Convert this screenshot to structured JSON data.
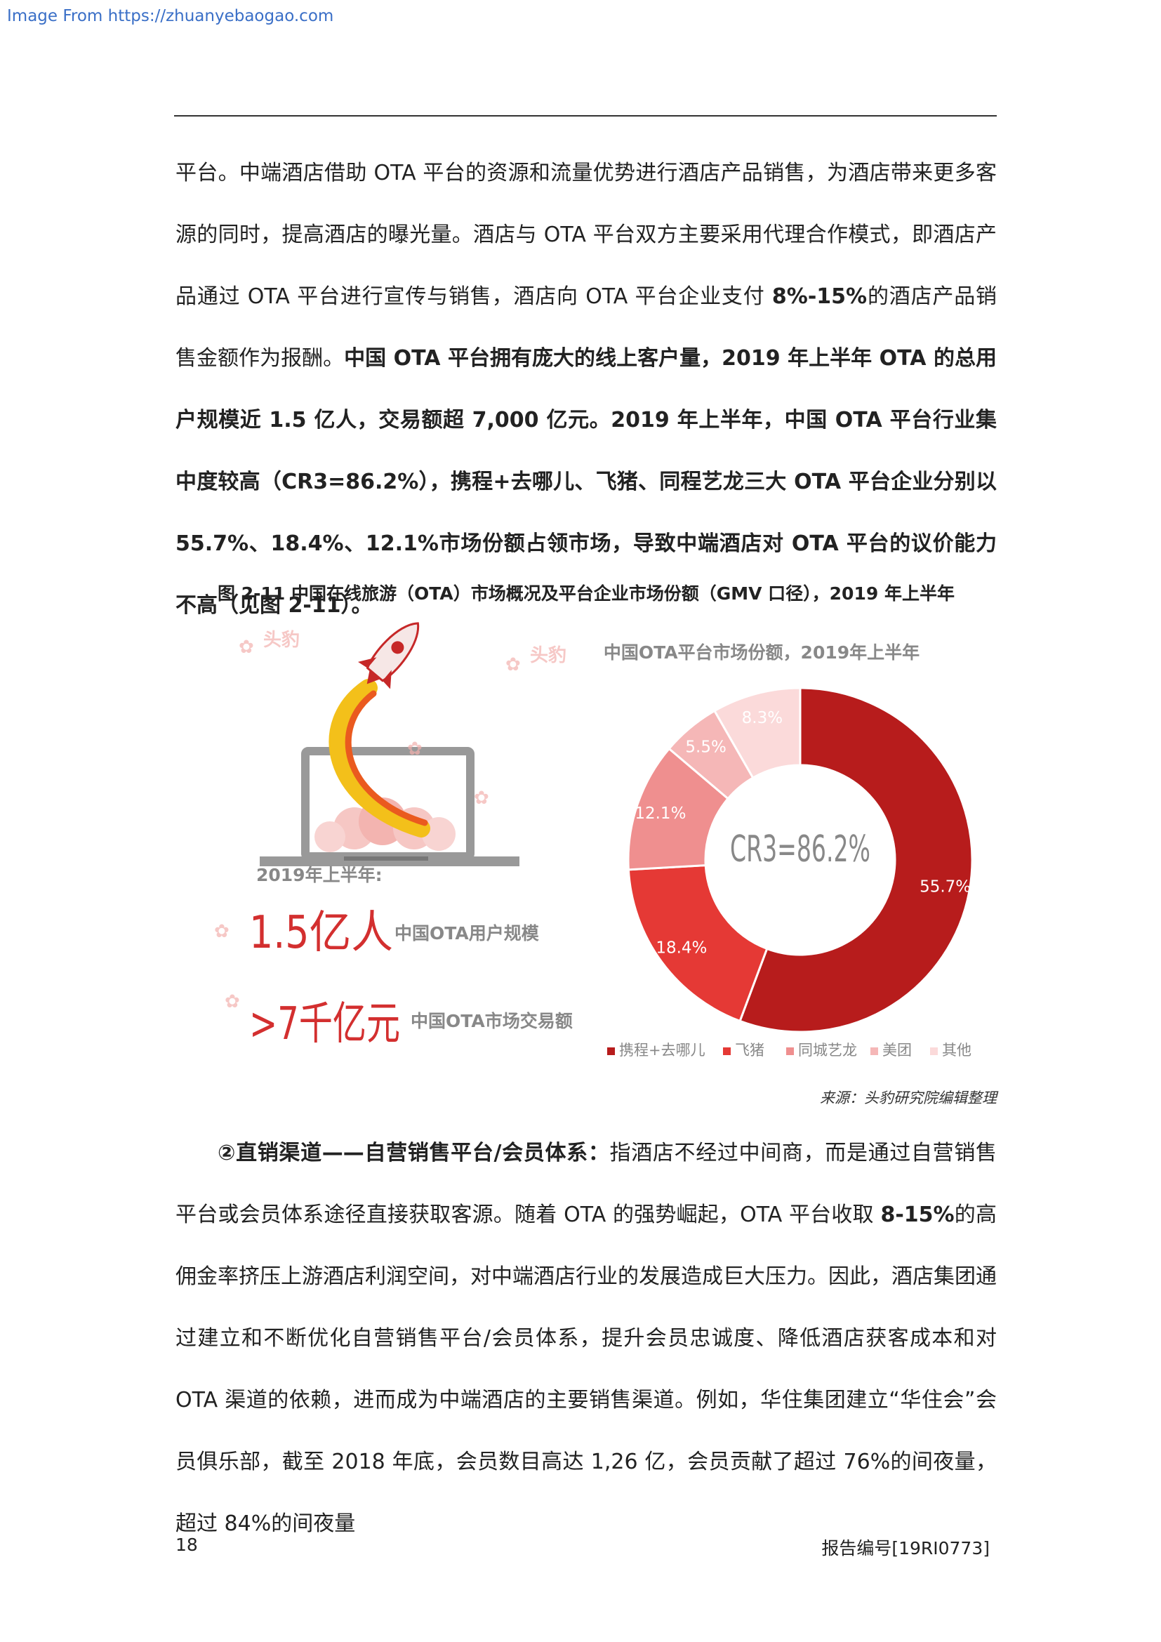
{
  "watermark": "Image From https://zhuanyebaogao.com",
  "paragraph1": [
    {
      "t": "平台。中端酒店借助 OTA 平台的资源和流量优势进行酒店产品销售，为酒店带来更多客源的同时，提高酒店的曝光量。酒店与 OTA 平台双方主要采用代理合作模式，即酒店产品通过 OTA 平台进行宣传与销售，酒店向 OTA 平台企业支付 ",
      "b": false
    },
    {
      "t": "8%-15%",
      "b": true
    },
    {
      "t": "的酒店产品销售金额作为报酬。",
      "b": false
    },
    {
      "t": "中国 OTA 平台拥有庞大的线上客户量，2019 年上半年 OTA 的总用户规模近 1.5 亿人，交易额超 7,000 亿元。2019 年上半年，中国 OTA 平台行业集中度较高（CR3=86.2%），携程+去哪儿、飞猪、同程艺龙三大 OTA 平台企业分别以 55.7%、18.4%、12.1%市场份额占领市场，导致中端酒店对 OTA 平台的议价能力不高（见图 2-11）。",
      "b": true
    }
  ],
  "figure": {
    "title": "图 2-11  中国在线旅游（OTA）市场概况及平台企业市场份额（GMV 口径），2019 年上半年",
    "left_panel": {
      "period_label": "2019年上半年:",
      "users_value": "1.5亿人",
      "users_label": "中国OTA用户规模",
      "gmv_value": ">7千亿元",
      "gmv_label": "中国OTA市场交易额",
      "watermark_text": "头豹"
    },
    "source": "来源：头豹研究院编辑整理"
  },
  "chart_data": {
    "type": "pie",
    "title": "中国OTA平台市场份额，2019年上半年",
    "center_label": "CR3=86.2%",
    "slices": [
      {
        "name": "携程+去哪儿",
        "value": 55.7,
        "label": "55.7%",
        "color": "#b71c1c"
      },
      {
        "name": "飞猪",
        "value": 18.4,
        "label": "18.4%",
        "color": "#e53935"
      },
      {
        "name": "同城艺龙",
        "value": 12.1,
        "label": "12.1%",
        "color": "#ef8f8f"
      },
      {
        "name": "美团",
        "value": 5.5,
        "label": "5.5%",
        "color": "#f5b7b7"
      },
      {
        "name": "其他",
        "value": 8.3,
        "label": "8.3%",
        "color": "#fbdada"
      }
    ],
    "legend_position": "bottom"
  },
  "paragraph2": [
    {
      "t": "②直销渠道——自营销售平台/会员体系：",
      "b": true
    },
    {
      "t": "指酒店不经过中间商，而是通过自营销售平台或会员体系途径直接获取客源。随着 OTA 的强势崛起，OTA 平台收取 ",
      "b": false
    },
    {
      "t": "8-15%",
      "b": true
    },
    {
      "t": "的高佣金率挤压上游酒店利润空间，对中端酒店行业的发展造成巨大压力。因此，酒店集团通过建立和不断优化自营销售平台/会员体系，提升会员忠诚度、降低酒店获客成本和对 OTA 渠道的依赖，进而成为中端酒店的主要销售渠道。例如，华住集团建立“华住会”会员俱乐部，截至 2018 年底，会员数目高达 1,26 亿，会员贡献了超过 76%的间夜量，超过 84%的间夜量",
      "b": false
    }
  ],
  "footer": {
    "page_number": "18",
    "report_no": "报告编号[19RI0773]"
  }
}
